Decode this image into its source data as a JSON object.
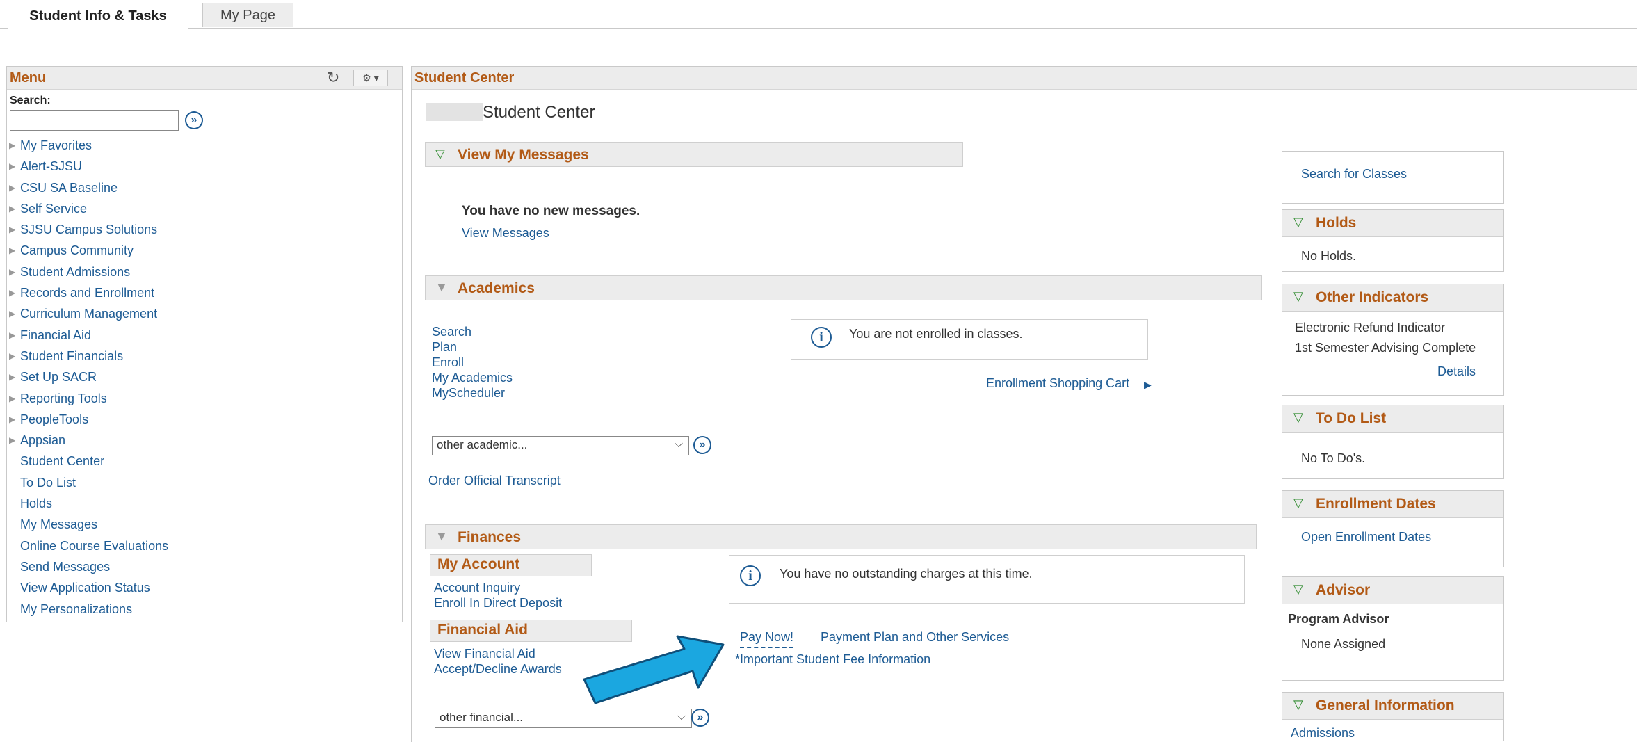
{
  "tabs": [
    {
      "label": "Student Info & Tasks",
      "active": true
    },
    {
      "label": "My Page",
      "active": false
    }
  ],
  "menu": {
    "title": "Menu",
    "search_label": "Search:",
    "search_value": "",
    "items": [
      {
        "label": "My Favorites",
        "folder": true
      },
      {
        "label": "Alert-SJSU",
        "folder": true
      },
      {
        "label": "CSU SA Baseline",
        "folder": true
      },
      {
        "label": "Self Service",
        "folder": true
      },
      {
        "label": "SJSU Campus Solutions",
        "folder": true
      },
      {
        "label": "Campus Community",
        "folder": true
      },
      {
        "label": "Student Admissions",
        "folder": true
      },
      {
        "label": "Records and Enrollment",
        "folder": true
      },
      {
        "label": "Curriculum Management",
        "folder": true
      },
      {
        "label": "Financial Aid",
        "folder": true
      },
      {
        "label": "Student Financials",
        "folder": true
      },
      {
        "label": "Set Up SACR",
        "folder": true
      },
      {
        "label": "Reporting Tools",
        "folder": true
      },
      {
        "label": "PeopleTools",
        "folder": true
      },
      {
        "label": "Appsian",
        "folder": true
      },
      {
        "label": "Student Center",
        "folder": false
      },
      {
        "label": "To Do List",
        "folder": false
      },
      {
        "label": "Holds",
        "folder": false
      },
      {
        "label": "My Messages",
        "folder": false
      },
      {
        "label": "Online Course Evaluations",
        "folder": false
      },
      {
        "label": "Send Messages",
        "folder": false
      },
      {
        "label": "View Application Status",
        "folder": false
      },
      {
        "label": "My Personalizations",
        "folder": false
      }
    ]
  },
  "student_center": {
    "panel_title": "Student Center",
    "page_title": "Student Center",
    "messages": {
      "header": "View My Messages",
      "no_messages": "You have no new messages.",
      "view_link": "View Messages"
    },
    "academics": {
      "header": "Academics",
      "links": [
        "Search",
        "Plan",
        "Enroll",
        "My Academics",
        "MyScheduler"
      ],
      "not_enrolled": "You are not enrolled in classes.",
      "shopping_cart": "Enrollment Shopping Cart",
      "dropdown": "other academic...",
      "transcript_link": "Order Official Transcript"
    },
    "finances": {
      "header": "Finances",
      "my_account_header": "My Account",
      "account_links": [
        "Account Inquiry",
        "Enroll In Direct Deposit"
      ],
      "financial_aid_header": "Financial Aid",
      "aid_links": [
        "View Financial Aid",
        "Accept/Decline Awards"
      ],
      "no_charges": "You have no outstanding charges at this time.",
      "pay_now": "Pay Now!",
      "payment_plan": "Payment Plan and Other Services",
      "fee_info": "*Important Student Fee Information",
      "dropdown": "other financial..."
    }
  },
  "right_column": {
    "search_classes": "Search for Classes",
    "holds": {
      "header": "Holds",
      "text": "No Holds."
    },
    "other_indicators": {
      "header": "Other Indicators",
      "items": [
        "Electronic Refund Indicator",
        "1st Semester Advising Complete"
      ],
      "details": "Details"
    },
    "todo": {
      "header": "To Do List",
      "text": "No To Do's."
    },
    "enrollment_dates": {
      "header": "Enrollment Dates",
      "link": "Open Enrollment Dates"
    },
    "advisor": {
      "header": "Advisor",
      "label": "Program Advisor",
      "value": "None Assigned"
    },
    "general_info": {
      "header": "General Information",
      "link": "Admissions"
    }
  },
  "colors": {
    "accent_orange": "#b25a16",
    "link_blue": "#1d5b94",
    "arrow_blue": "#1ba7e0",
    "header_grey": "#ececec"
  }
}
